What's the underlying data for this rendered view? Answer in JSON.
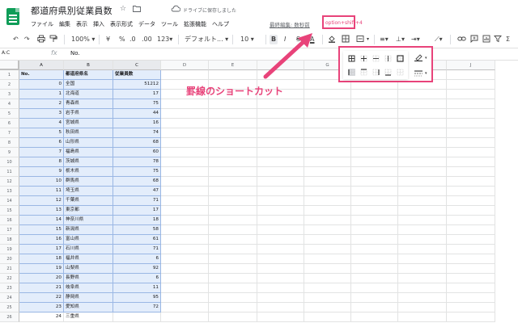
{
  "doc": {
    "title": "都道府県別従業員数",
    "saved_status": "ドライブに保存しました",
    "menu": [
      "ファイル",
      "編集",
      "表示",
      "挿入",
      "表示形式",
      "データ",
      "ツール",
      "拡張機能",
      "ヘルプ"
    ],
    "last_edit": "最終編集: 数秒前",
    "shortcut": "option+shift+4"
  },
  "toolbar": {
    "zoom": "100%",
    "currency": "¥",
    "percent": "%",
    "dec_decrease": ".0",
    "dec_increase": ".00",
    "number_format": "123",
    "font": "デフォルト...",
    "font_size": "10",
    "bold": "B",
    "italic": "I",
    "strike": "S",
    "text_color": "A"
  },
  "formula_bar": {
    "cell_ref": "A:C",
    "fx": "fx",
    "value": "No."
  },
  "columns": [
    "A",
    "B",
    "C",
    "D",
    "E",
    "F",
    "G",
    "H",
    "I",
    "J"
  ],
  "row_numbers": [
    "1",
    "2",
    "3",
    "4",
    "5",
    "6",
    "7",
    "8",
    "9",
    "10",
    "11",
    "12",
    "13",
    "14",
    "15",
    "16",
    "17",
    "18",
    "19",
    "20",
    "21",
    "22",
    "23",
    "24",
    "25",
    "26"
  ],
  "table": {
    "headers": [
      "No.",
      "都道府県名",
      "従業員数"
    ],
    "rows": [
      [
        "0",
        "全国",
        "51212"
      ],
      [
        "1",
        "北海道",
        "17"
      ],
      [
        "2",
        "青森県",
        "75"
      ],
      [
        "3",
        "岩手県",
        "44"
      ],
      [
        "4",
        "宮城県",
        "16"
      ],
      [
        "5",
        "秋田県",
        "74"
      ],
      [
        "6",
        "山形県",
        "68"
      ],
      [
        "7",
        "福島県",
        "60"
      ],
      [
        "8",
        "茨城県",
        "78"
      ],
      [
        "9",
        "栃木県",
        "75"
      ],
      [
        "10",
        "群馬県",
        "68"
      ],
      [
        "11",
        "埼玉県",
        "47"
      ],
      [
        "12",
        "千葉県",
        "71"
      ],
      [
        "13",
        "東京都",
        "17"
      ],
      [
        "14",
        "神奈川県",
        "18"
      ],
      [
        "15",
        "新潟県",
        "58"
      ],
      [
        "16",
        "富山県",
        "61"
      ],
      [
        "17",
        "石川県",
        "71"
      ],
      [
        "18",
        "福井県",
        "6"
      ],
      [
        "19",
        "山梨県",
        "92"
      ],
      [
        "20",
        "長野県",
        "6"
      ],
      [
        "21",
        "岐阜県",
        "11"
      ],
      [
        "22",
        "静岡県",
        "95"
      ],
      [
        "23",
        "愛知県",
        "72"
      ],
      [
        "24",
        "三重県",
        ""
      ]
    ]
  },
  "callout": "罫線のショートカット",
  "colors": {
    "accent": "#e8437a",
    "selection": "#e3edfb",
    "sheets_green": "#0f9d58"
  },
  "icons": {
    "logo": "sheets-logo-icon",
    "star": "star-icon",
    "folder": "folder-icon",
    "cloud": "cloud-icon",
    "undo": "undo-icon",
    "redo": "redo-icon",
    "print": "print-icon",
    "paint_format": "paint-format-icon",
    "fill_color": "fill-color-icon",
    "borders": "borders-icon",
    "merge": "merge-icon",
    "align": "align-icon",
    "valign": "valign-icon",
    "wrap": "wrap-icon",
    "rotate": "rotate-icon",
    "link": "link-icon",
    "comment": "comment-icon",
    "chart": "chart-icon",
    "filter": "filter-icon",
    "functions": "functions-icon",
    "border_options": [
      "all-borders-icon",
      "inner-borders-icon",
      "horizontal-borders-icon",
      "vertical-borders-icon",
      "outer-borders-icon",
      "left-border-icon",
      "top-border-icon",
      "right-border-icon",
      "bottom-border-icon",
      "clear-borders-icon",
      "border-color-icon",
      "border-style-icon"
    ]
  }
}
